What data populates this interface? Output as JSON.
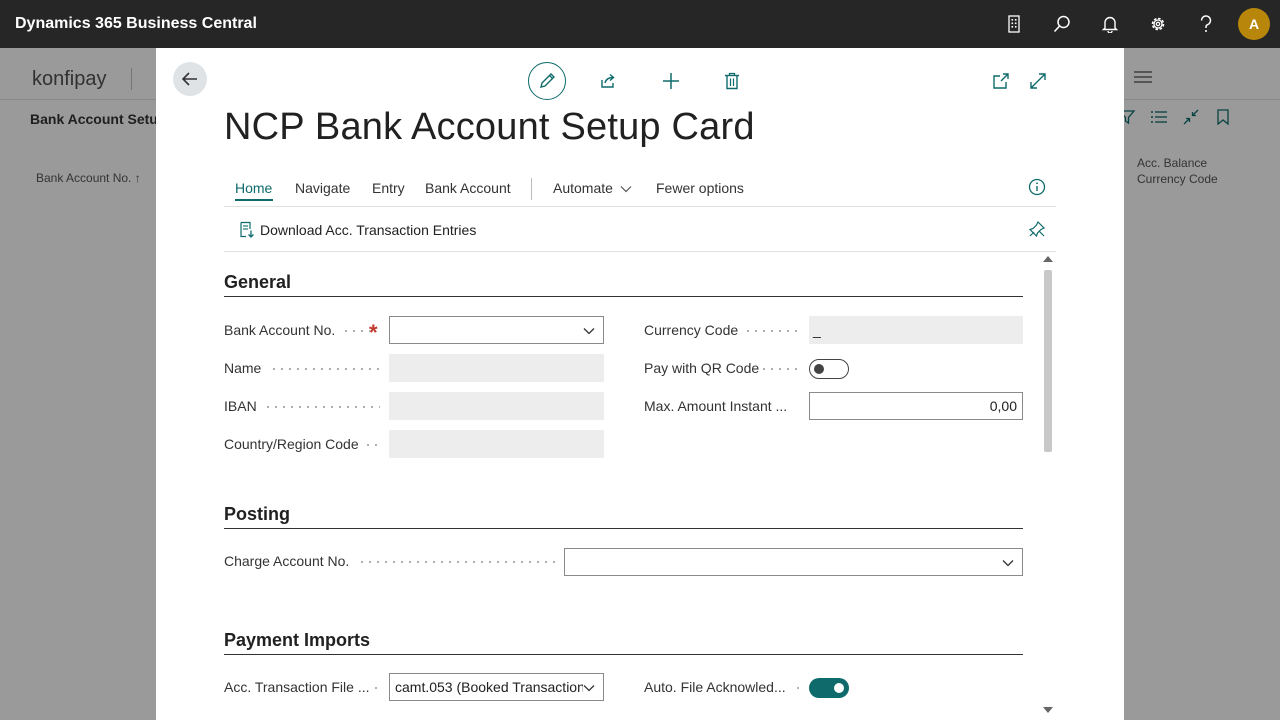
{
  "app": {
    "title": "Dynamics 365 Business Central",
    "avatar_initial": "A"
  },
  "appbar_icons": [
    "building-icon",
    "search-icon",
    "bell-icon",
    "gear-icon",
    "help-icon"
  ],
  "background": {
    "company": "konfipay",
    "breadcrumb": "Bank Account Setup",
    "col_bank_account_no": "Bank Account No. ↑",
    "col_acc_balance_currency": "Acc. Balance Currency Code"
  },
  "dialog": {
    "title": "NCP Bank Account Setup Card",
    "actions": {
      "home": "Home",
      "navigate": "Navigate",
      "entry": "Entry",
      "bank_account": "Bank Account",
      "automate": "Automate",
      "fewer_options": "Fewer options"
    },
    "promoted_action": "Download Acc. Transaction Entries"
  },
  "sections": {
    "general": {
      "title": "General",
      "bank_account_no_label": "Bank Account No.",
      "bank_account_no_value": "",
      "name_label": "Name",
      "name_value": "",
      "iban_label": "IBAN",
      "iban_value": "",
      "country_label": "Country/Region Code",
      "country_value": "",
      "currency_label": "Currency Code",
      "currency_value": "_",
      "pay_qr_label": "Pay with QR Code",
      "pay_qr_on": false,
      "max_amount_label": "Max. Amount Instant ...",
      "max_amount_value": "0,00"
    },
    "posting": {
      "title": "Posting",
      "charge_account_label": "Charge Account No.",
      "charge_account_value": ""
    },
    "payment_imports": {
      "title": "Payment Imports",
      "acc_transaction_file_label": "Acc. Transaction File ...",
      "acc_transaction_file_value": "camt.053 (Booked Transaction",
      "auto_file_ack_label": "Auto. File Acknowled...",
      "auto_file_ack_on": true
    }
  },
  "colors": {
    "accent": "#0f6b6b",
    "appbar": "#262626",
    "avatar": "#b8860b",
    "required": "#c0392b"
  }
}
